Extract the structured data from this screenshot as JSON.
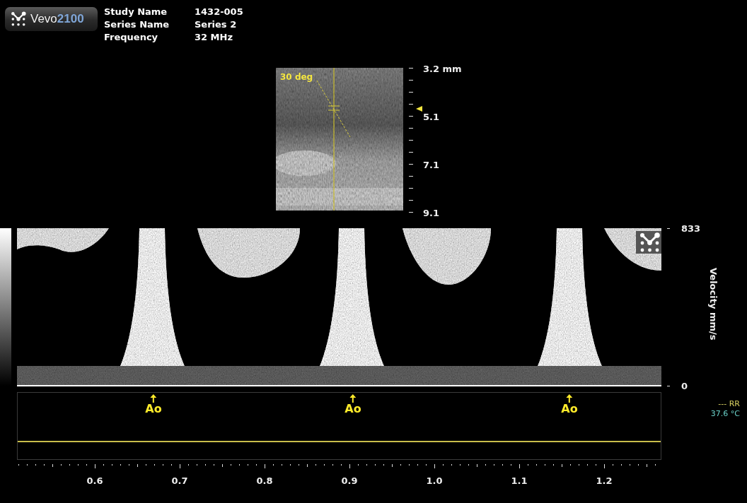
{
  "logo": {
    "name": "Vevo",
    "model": "2100"
  },
  "study_info": [
    {
      "label": "Study Name",
      "value": "1432-005"
    },
    {
      "label": "Series Name",
      "value": "Series 2"
    },
    {
      "label": "Frequency",
      "value": "32 MHz"
    }
  ],
  "bmode_image": {
    "angle_label": "30 deg",
    "depth_labels": [
      "3.2 mm",
      "5.1",
      "7.1",
      "9.1"
    ]
  },
  "doppler": {
    "velocity_title": "Velocity mm/s",
    "max_label": "833",
    "min_label": "0"
  },
  "ecg": {
    "markers": [
      {
        "label": "Ao"
      },
      {
        "label": "Ao"
      },
      {
        "label": "Ao"
      }
    ],
    "respiration": "--- RR",
    "temperature": "37.6 °C"
  },
  "time_axis": {
    "labels": [
      "0.6",
      "0.7",
      "0.8",
      "0.9",
      "1.0",
      "1.1",
      "1.2"
    ]
  }
}
